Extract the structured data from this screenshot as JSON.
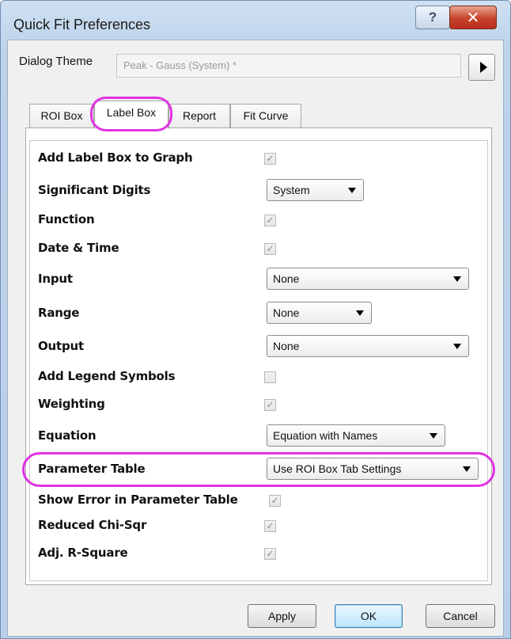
{
  "window": {
    "title": "Quick Fit Preferences",
    "help_glyph": "?",
    "close_glyph": "✕"
  },
  "theme": {
    "label": "Dialog Theme",
    "value": "Peak - Gauss (System) *"
  },
  "tabs": [
    {
      "label": "ROI Box",
      "active": false
    },
    {
      "label": "Label Box",
      "active": true
    },
    {
      "label": "Report",
      "active": false
    },
    {
      "label": "Fit Curve",
      "active": false
    }
  ],
  "rows": {
    "add_label_box": {
      "label": "Add Label Box to Graph",
      "checked": true
    },
    "significant_digits": {
      "label": "Significant Digits",
      "value": "System"
    },
    "function": {
      "label": "Function",
      "checked": true
    },
    "date_time": {
      "label": "Date & Time",
      "checked": true
    },
    "input": {
      "label": "Input",
      "value": "None"
    },
    "range": {
      "label": "Range",
      "value": "None"
    },
    "output": {
      "label": "Output",
      "value": "None"
    },
    "add_legend_symbols": {
      "label": "Add Legend Symbols",
      "checked": false
    },
    "weighting": {
      "label": "Weighting",
      "checked": true
    },
    "equation": {
      "label": "Equation",
      "value": "Equation with Names"
    },
    "parameter_table": {
      "label": "Parameter Table",
      "value": "Use ROI Box Tab Settings"
    },
    "show_error": {
      "label": "Show Error in Parameter Table",
      "checked": true
    },
    "reduced_chisqr": {
      "label": "Reduced Chi-Sqr",
      "checked": true
    },
    "adj_rsquare": {
      "label": "Adj. R-Square",
      "checked": true
    }
  },
  "check_glyph": "✓",
  "buttons": {
    "apply": "Apply",
    "ok": "OK",
    "cancel": "Cancel"
  },
  "colors": {
    "highlight": "#e233e2",
    "titlebar": "#bdd3ea",
    "close": "#c8422b"
  }
}
